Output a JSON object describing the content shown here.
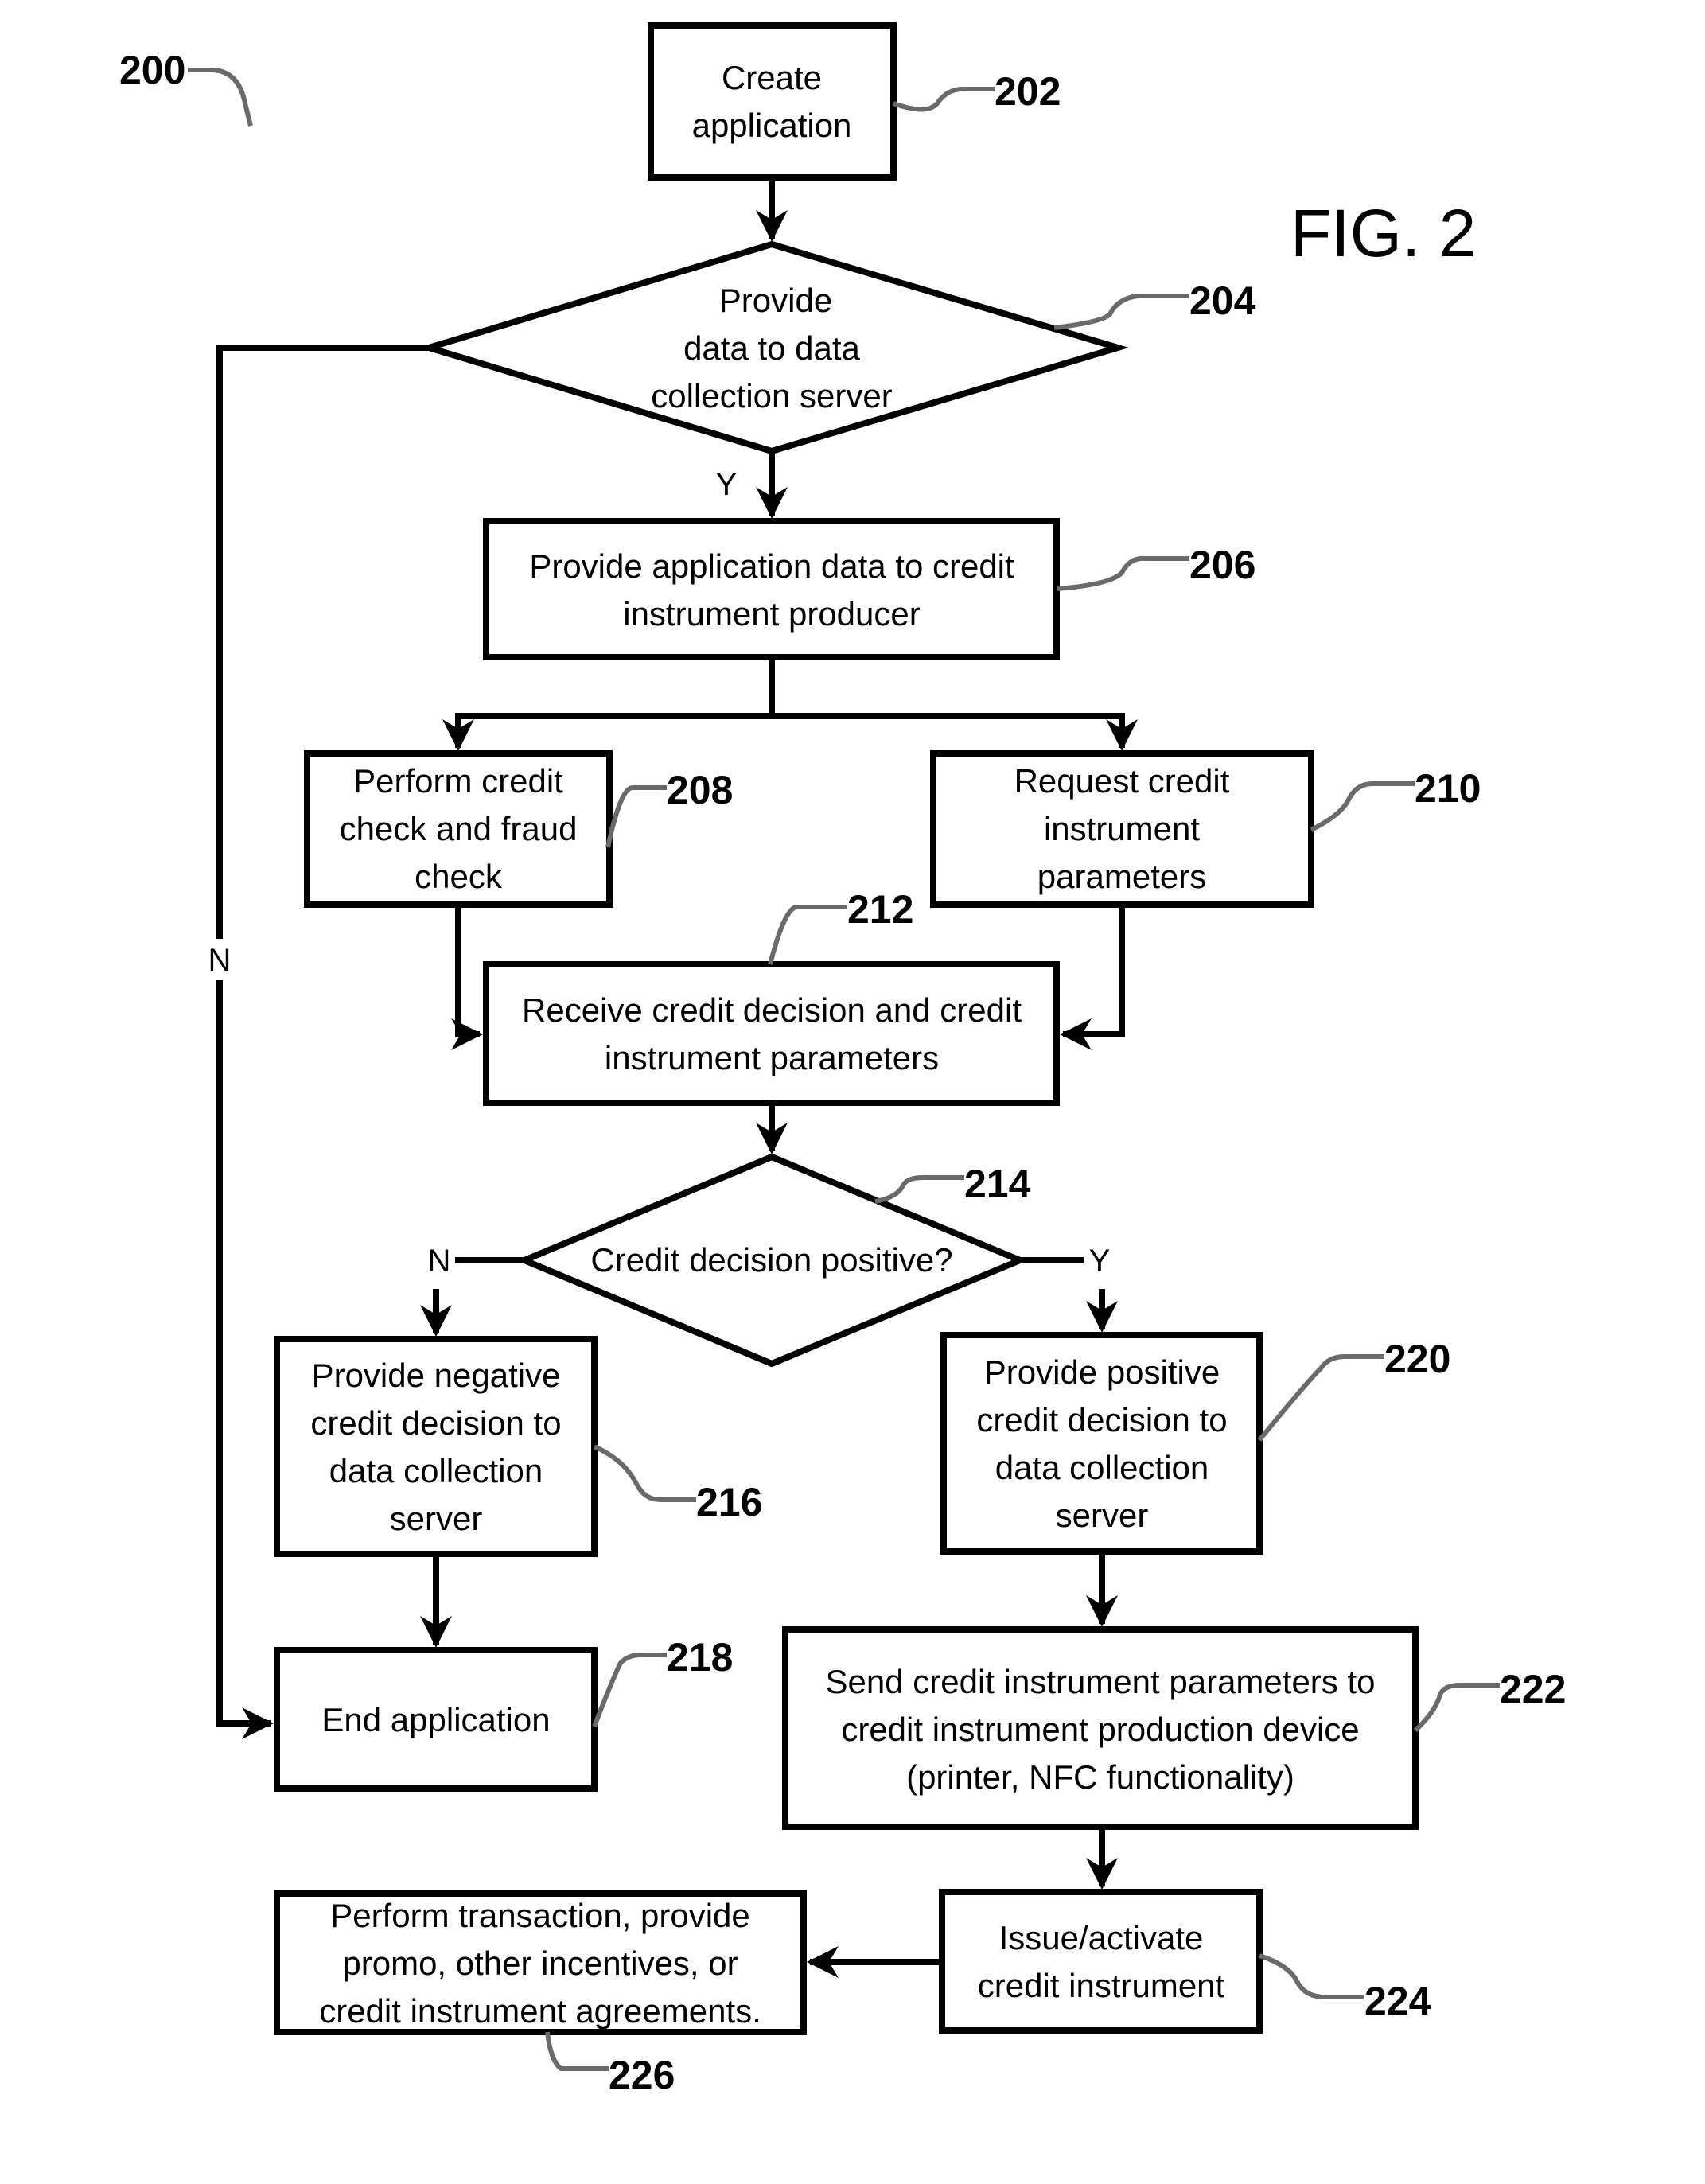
{
  "figure": {
    "label": "FIG. 2",
    "reference": "200"
  },
  "nodes": {
    "create_application": {
      "ref": "202",
      "lines": [
        "Create",
        "application"
      ]
    },
    "provide_data_decision": {
      "ref": "204",
      "lines": [
        "Provide",
        "data to data",
        "collection server"
      ]
    },
    "provide_application_data": {
      "ref": "206",
      "lines": [
        "Provide application data to credit",
        "instrument producer"
      ]
    },
    "credit_fraud_check": {
      "ref": "208",
      "lines": [
        "Perform credit",
        "check and fraud",
        "check"
      ]
    },
    "request_parameters": {
      "ref": "210",
      "lines": [
        "Request credit",
        "instrument",
        "parameters"
      ]
    },
    "receive_decision": {
      "ref": "212",
      "lines": [
        "Receive credit decision and credit",
        "instrument parameters"
      ]
    },
    "credit_positive_decision": {
      "ref": "214",
      "lines": [
        "Credit decision positive?"
      ]
    },
    "negative_decision": {
      "ref": "216",
      "lines": [
        "Provide negative",
        "credit decision to",
        "data collection",
        "server"
      ]
    },
    "end_application": {
      "ref": "218",
      "lines": [
        "End application"
      ]
    },
    "positive_decision": {
      "ref": "220",
      "lines": [
        "Provide positive",
        "credit decision to",
        "data collection",
        "server"
      ]
    },
    "send_parameters": {
      "ref": "222",
      "lines": [
        "Send credit instrument parameters to",
        "credit instrument production device",
        "(printer, NFC functionality)"
      ]
    },
    "issue_activate": {
      "ref": "224",
      "lines": [
        "Issue/activate",
        "credit instrument"
      ]
    },
    "perform_transaction": {
      "ref": "226",
      "lines": [
        "Perform transaction, provide",
        "promo, other incentives, or",
        "credit instrument agreements."
      ]
    }
  },
  "edge_labels": {
    "d204_yes": "Y",
    "d204_no": "N",
    "d214_no": "N",
    "d214_yes": "Y"
  }
}
